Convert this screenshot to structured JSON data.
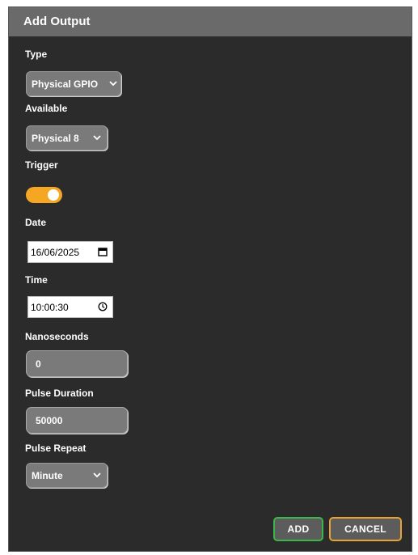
{
  "dialog": {
    "title": "Add Output"
  },
  "fields": {
    "type": {
      "label": "Type",
      "value": "Physical GPIO"
    },
    "available": {
      "label": "Available",
      "value": "Physical 8"
    },
    "trigger": {
      "label": "Trigger",
      "enabled": true
    },
    "date": {
      "label": "Date",
      "value": "16/06/2025"
    },
    "time": {
      "label": "Time",
      "value": "10:00:30"
    },
    "nanoseconds": {
      "label": "Nanoseconds",
      "value": "0"
    },
    "pulse_duration": {
      "label": "Pulse Duration",
      "value": "50000"
    },
    "pulse_repeat": {
      "label": "Pulse Repeat",
      "value": "Minute"
    }
  },
  "buttons": {
    "add": "ADD",
    "cancel": "CANCEL"
  },
  "colors": {
    "toggle_on": "#f5a623",
    "add_border": "#3cb54a",
    "cancel_border": "#e8a133",
    "dialog_bg": "#2b2b2b",
    "header_bg": "#6a6a6a"
  },
  "icons": {
    "select": "chevron-down-icon",
    "date": "calendar-icon",
    "time": "clock-icon"
  }
}
